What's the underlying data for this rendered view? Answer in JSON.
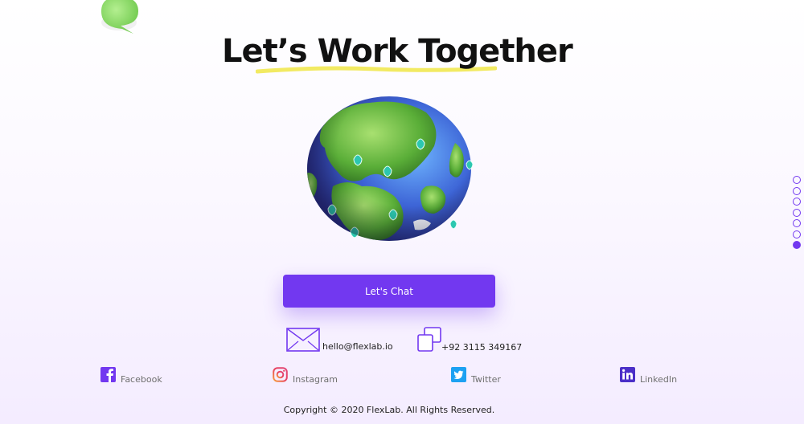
{
  "hero": {
    "title": "Let’s Work Together"
  },
  "cta": {
    "label": "Let's Chat"
  },
  "contact": {
    "email": "hello@flexlab.io",
    "phone": "+92 3115 349167"
  },
  "social": [
    {
      "label": "Facebook",
      "icon": "facebook-icon"
    },
    {
      "label": "Instagram",
      "icon": "instagram-icon"
    },
    {
      "label": "Twitter",
      "icon": "twitter-icon"
    },
    {
      "label": "LinkedIn",
      "icon": "linkedin-icon"
    }
  ],
  "footer": {
    "copyright": "Copyright © 2020 FlexLab. All Rights Reserved."
  },
  "page_nav": {
    "dot_count": 7,
    "active_index": 6
  },
  "colors": {
    "accent": "#7238f0",
    "background": "#fbf8ff",
    "underline": "#f2ea62",
    "chat_bubble": "#8ddc6a",
    "globe_land": "#5aae38",
    "globe_ocean": "#3d64d6"
  }
}
